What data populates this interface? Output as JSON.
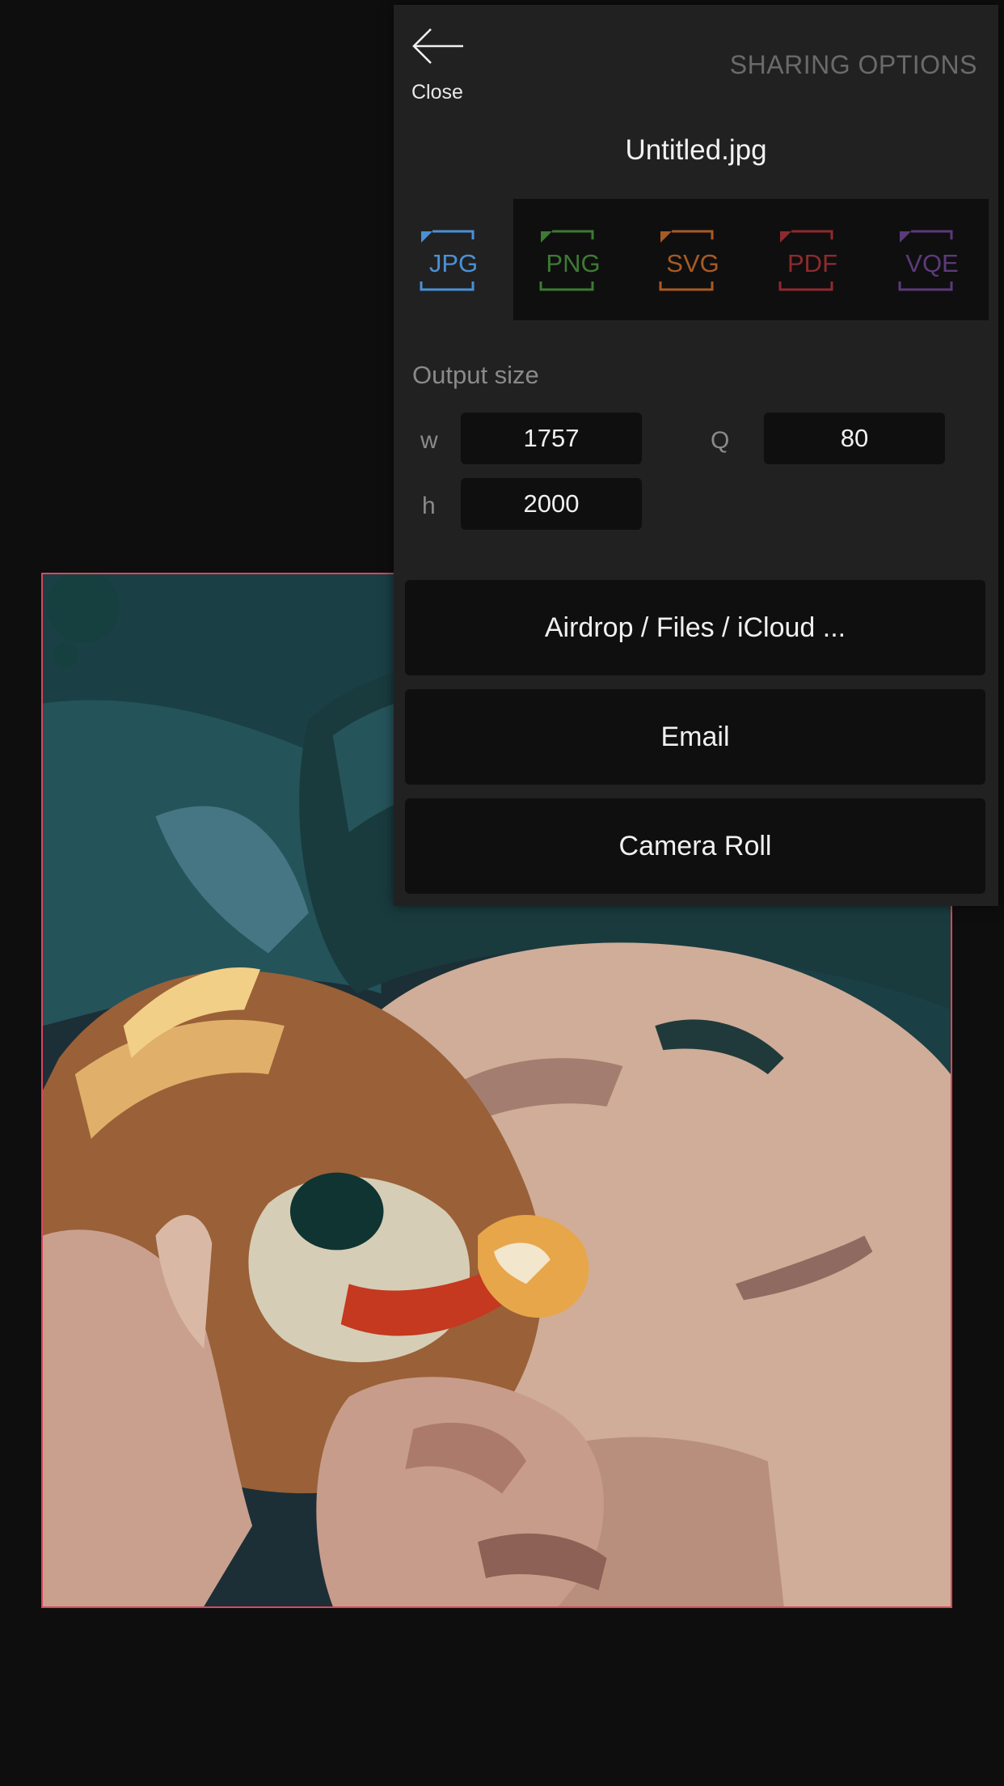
{
  "panel": {
    "title": "SHARING OPTIONS",
    "close_label": "Close",
    "file_name": "Untitled.jpg"
  },
  "formats": [
    {
      "label": "JPG",
      "color": "#4a90d6",
      "selected": true
    },
    {
      "label": "PNG",
      "color": "#3d7a33",
      "selected": false
    },
    {
      "label": "SVG",
      "color": "#a85a24",
      "selected": false
    },
    {
      "label": "PDF",
      "color": "#8e2a2e",
      "selected": false
    },
    {
      "label": "VQE",
      "color": "#5b3a7a",
      "selected": false
    }
  ],
  "output": {
    "section_label": "Output size",
    "width_label": "w",
    "width_value": "1757",
    "height_label": "h",
    "height_value": "2000",
    "quality_label": "Q",
    "quality_value": "80"
  },
  "actions": {
    "airdrop": "Airdrop / Files / iCloud ...",
    "email": "Email",
    "camera_roll": "Camera Roll"
  },
  "colors": {
    "background": "#0e0e0e",
    "panel": "#212121",
    "field": "#0f0f0f",
    "artwork_border": "#d9475d"
  }
}
